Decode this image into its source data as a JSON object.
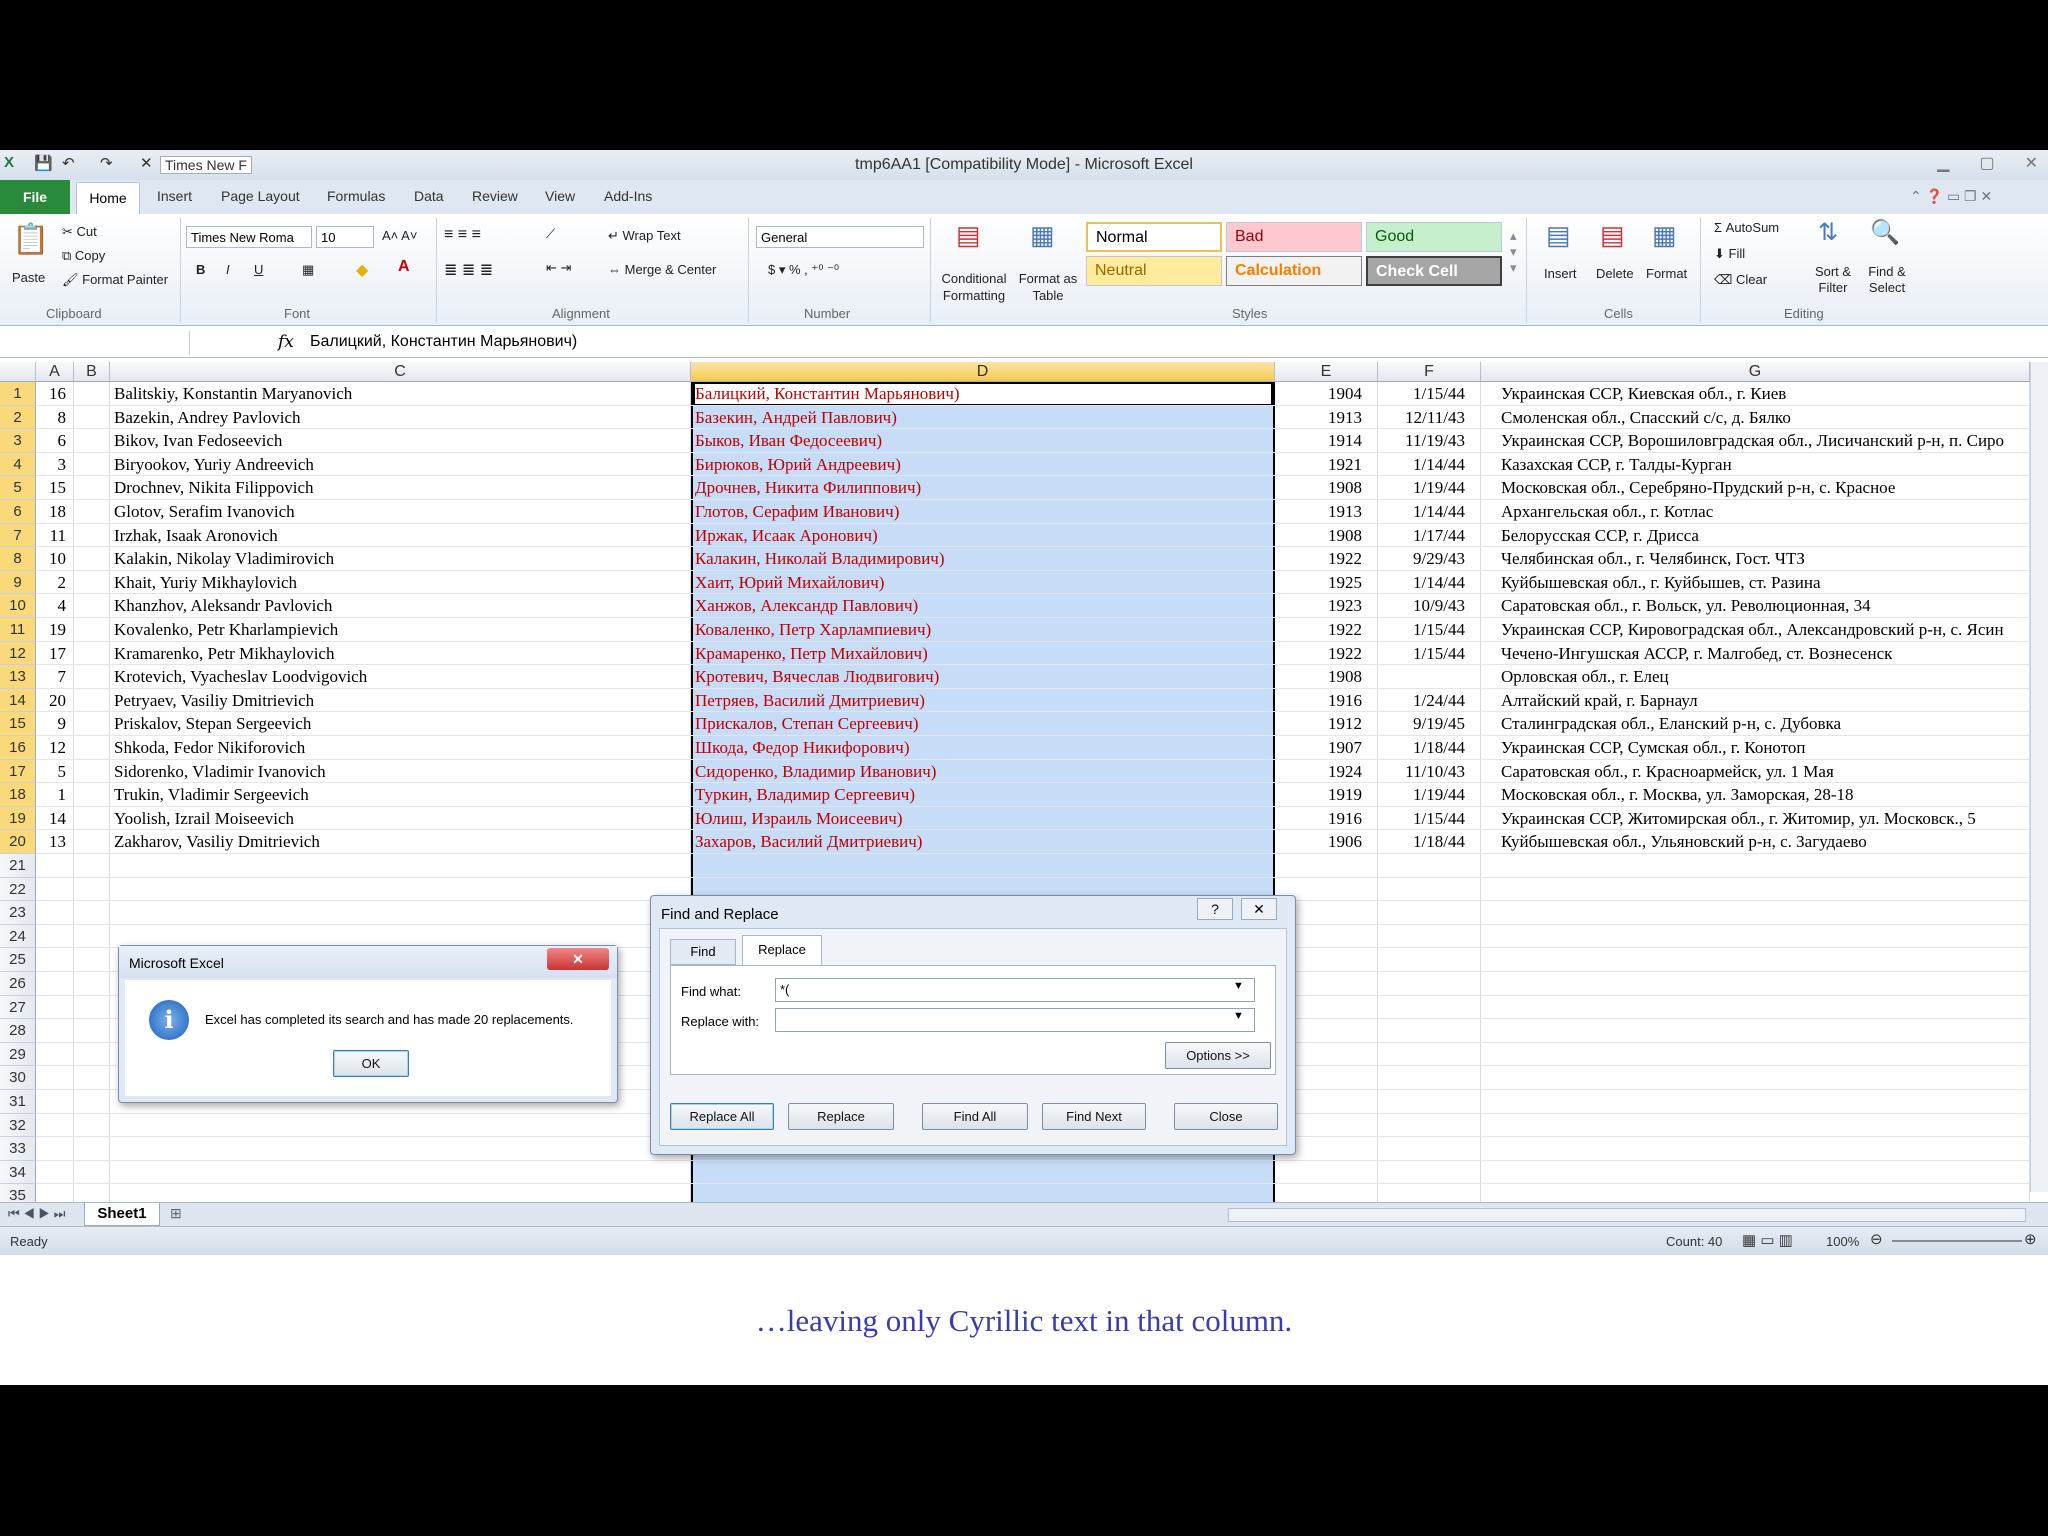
{
  "title": "tmp6AA1  [Compatibility Mode] - Microsoft Excel",
  "qat": {
    "font": "Times New F"
  },
  "tabs": [
    "File",
    "Home",
    "Insert",
    "Page Layout",
    "Formulas",
    "Data",
    "Review",
    "View",
    "Add-Ins"
  ],
  "ribbon": {
    "clipboard": {
      "paste": "Paste",
      "cut": "Cut",
      "copy": "Copy",
      "format_painter": "Format Painter",
      "group": "Clipboard"
    },
    "font": {
      "name": "Times New Roma",
      "size": "10",
      "group": "Font"
    },
    "alignment": {
      "wrap": "Wrap Text",
      "merge": "Merge & Center",
      "group": "Alignment"
    },
    "number": {
      "format": "General",
      "group": "Number"
    },
    "styles": {
      "cond": "Conditional Formatting",
      "fmt_table": "Format as Table",
      "normal": "Normal",
      "bad": "Bad",
      "good": "Good",
      "neutral": "Neutral",
      "calc": "Calculation",
      "check": "Check Cell",
      "group": "Styles"
    },
    "cells": {
      "insert": "Insert",
      "delete": "Delete",
      "format": "Format",
      "group": "Cells"
    },
    "editing": {
      "autosum": "AutoSum",
      "fill": "Fill",
      "clear": "Clear",
      "sort": "Sort & Filter",
      "find": "Find & Select",
      "group": "Editing"
    }
  },
  "formula_bar": {
    "fx": "fx",
    "value": "Балицкий, Константин Марьянович)"
  },
  "columns": [
    "A",
    "B",
    "C",
    "D",
    "E",
    "F",
    "G"
  ],
  "rows": [
    {
      "a": "16",
      "c": "Balitskiy, Konstantin Maryanovich",
      "d": "Балицкий, Константин Марьянович)",
      "e": "1904",
      "f": "1/15/44",
      "g": "Украинская ССР, Киевская обл., г. Киев"
    },
    {
      "a": "8",
      "c": "Bazekin, Andrey Pavlovich",
      "d": "Базекин, Андрей Павлович)",
      "e": "1913",
      "f": "12/11/43",
      "g": "Смоленская обл., Спасский с/с, д. Бялко"
    },
    {
      "a": "6",
      "c": "Bikov, Ivan Fedoseevich",
      "d": "Быков, Иван Федосеевич)",
      "e": "1914",
      "f": "11/19/43",
      "g": "Украинская ССР, Ворошиловградская обл., Лисичанский р-н, п. Сиро"
    },
    {
      "a": "3",
      "c": "Biryookov, Yuriy Andreevich",
      "d": "Бирюков, Юрий Андреевич)",
      "e": "1921",
      "f": "1/14/44",
      "g": "Казахская ССР, г. Талды-Курган"
    },
    {
      "a": "15",
      "c": "Drochnev, Nikita Filippovich",
      "d": "Дрочнев, Никита Филиппович)",
      "e": "1908",
      "f": "1/19/44",
      "g": "Московская обл., Серебряно-Прудский р-н, с. Красное"
    },
    {
      "a": "18",
      "c": "Glotov, Serafim Ivanovich",
      "d": "Глотов, Серафим Иванович)",
      "e": "1913",
      "f": "1/14/44",
      "g": "Архангельская обл., г. Котлас"
    },
    {
      "a": "11",
      "c": "Irzhak, Isaak Aronovich",
      "d": "Иржак, Исаак Аронович)",
      "e": "1908",
      "f": "1/17/44",
      "g": "Белорусская ССР, г. Дрисса"
    },
    {
      "a": "10",
      "c": "Kalakin, Nikolay Vladimirovich",
      "d": "Калакин, Николай Владимирович)",
      "e": "1922",
      "f": "9/29/43",
      "g": "Челябинская обл., г. Челябинск, Гост. ЧТЗ"
    },
    {
      "a": "2",
      "c": "Khait, Yuriy Mikhaylovich",
      "d": "Хаит, Юрий Михайлович)",
      "e": "1925",
      "f": "1/14/44",
      "g": "Куйбышевская обл., г. Куйбышев, ст. Разина"
    },
    {
      "a": "4",
      "c": "Khanzhov, Aleksandr Pavlovich",
      "d": "Ханжов, Александр Павлович)",
      "e": "1923",
      "f": "10/9/43",
      "g": "Саратовская обл., г. Вольск, ул. Революционная, 34"
    },
    {
      "a": "19",
      "c": "Kovalenko, Petr Kharlampievich",
      "d": "Коваленко, Петр Харлампиевич)",
      "e": "1922",
      "f": "1/15/44",
      "g": "Украинская ССР, Кировоградская обл., Александровский р-н, с. Ясин"
    },
    {
      "a": "17",
      "c": "Kramarenko, Petr Mikhaylovich",
      "d": "Крамаренко, Петр Михайлович)",
      "e": "1922",
      "f": "1/15/44",
      "g": "Чечено-Ингушская АССР, г. Малгобед, ст. Вознесенск"
    },
    {
      "a": "7",
      "c": "Krotevich, Vyacheslav Loodvigovich",
      "d": "Кротевич, Вячеслав Людвигович)",
      "e": "1908",
      "f": "",
      "g": "Орловская обл., г. Елец"
    },
    {
      "a": "20",
      "c": "Petryaev, Vasiliy Dmitrievich",
      "d": "Петряев, Василий Дмитриевич)",
      "e": "1916",
      "f": "1/24/44",
      "g": "Алтайский край, г. Барнаул"
    },
    {
      "a": "9",
      "c": "Priskalov, Stepan Sergeevich",
      "d": "Прискалов, Степан Сергеевич)",
      "e": "1912",
      "f": "9/19/45",
      "g": "Сталинградская обл., Еланский р-н, с. Дубовка"
    },
    {
      "a": "12",
      "c": "Shkoda, Fedor Nikiforovich",
      "d": "Шкода, Федор Никифорович)",
      "e": "1907",
      "f": "1/18/44",
      "g": "Украинская ССР, Сумская обл., г. Конотоп"
    },
    {
      "a": "5",
      "c": "Sidorenko, Vladimir Ivanovich",
      "d": "Сидоренко, Владимир Иванович)",
      "e": "1924",
      "f": "11/10/43",
      "g": "Саратовская обл., г. Красноармейск, ул. 1 Мая"
    },
    {
      "a": "1",
      "c": "Trukin, Vladimir Sergeevich",
      "d": "Туркин, Владимир Сергеевич)",
      "e": "1919",
      "f": "1/19/44",
      "g": "Московская обл., г. Москва, ул. Заморская, 28-18"
    },
    {
      "a": "14",
      "c": "Yoolish, Izrail Moiseevich",
      "d": "Юлиш, Израиль Моисеевич)",
      "e": "1916",
      "f": "1/15/44",
      "g": "Украинская ССР, Житомирская обл., г. Житомир, ул. Московск., 5"
    },
    {
      "a": "13",
      "c": "Zakharov, Vasiliy Dmitrievich",
      "d": "Захаров, Василий Дмитриевич)",
      "e": "1906",
      "f": "1/18/44",
      "g": "Куйбышевская обл., Ульяновский р-н, с. Загудаево"
    }
  ],
  "row_numbers": [
    "1",
    "2",
    "3",
    "4",
    "5",
    "6",
    "7",
    "8",
    "9",
    "10",
    "11",
    "12",
    "13",
    "14",
    "15",
    "16",
    "17",
    "18",
    "19",
    "20",
    "21",
    "22",
    "23",
    "24",
    "25",
    "26",
    "27",
    "28",
    "29",
    "30",
    "31",
    "32",
    "33",
    "34",
    "35"
  ],
  "msgbox": {
    "title": "Microsoft Excel",
    "message": "Excel has completed its search and has made 20 replacements.",
    "ok": "OK"
  },
  "find_replace": {
    "title": "Find and Replace",
    "tab_find": "Find",
    "tab_replace": "Replace",
    "find_label": "Find what:",
    "find_value": "*(",
    "replace_label": "Replace with:",
    "replace_value": "",
    "options": "Options >>",
    "replace_all": "Replace All",
    "replace": "Replace",
    "find_all": "Find All",
    "find_next": "Find Next",
    "close": "Close"
  },
  "sheet": {
    "name": "Sheet1"
  },
  "status": {
    "ready": "Ready",
    "count": "Count: 40",
    "zoom": "100%"
  },
  "caption": "…leaving only Cyrillic text in that column.",
  "colors": {
    "red_text": "#c00000",
    "selection": "#c6dcf7",
    "file_tab": "#2a8a3c",
    "caption": "#3b3bb0"
  }
}
